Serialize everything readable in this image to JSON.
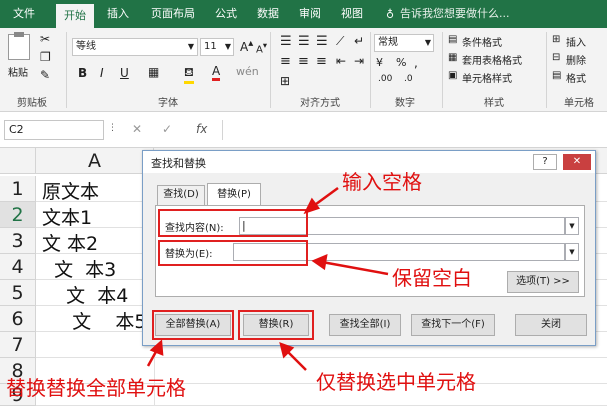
{
  "tabs": [
    "文件",
    "开始",
    "插入",
    "页面布局",
    "公式",
    "数据",
    "审阅",
    "视图"
  ],
  "tell_me": "告诉我您想要做什么...",
  "ribbon": {
    "paste": "粘贴",
    "clipboard": "剪贴板",
    "font_name": "等线",
    "font_size": "11",
    "bold": "B",
    "italic": "I",
    "underline": "U",
    "font_group": "字体",
    "align_group": "对齐方式",
    "number_format": "常规",
    "number_group": "数字",
    "conditional": "条件格式",
    "table_format": "套用表格格式",
    "cell_style": "单元格样式",
    "style_group": "样式",
    "insert": "插入",
    "delete": "删除",
    "format": "格式",
    "cells_group": "单元格"
  },
  "formula_bar": {
    "name_box": "C2",
    "fx": "fx"
  },
  "grid": {
    "col_a": "A",
    "rows": [
      {
        "num": "1",
        "text": "原文本"
      },
      {
        "num": "2",
        "text": "文本1"
      },
      {
        "num": "3",
        "text": "文 本2"
      },
      {
        "num": "4",
        "text": "  文  本3"
      },
      {
        "num": "5",
        "text": "    文  本4"
      },
      {
        "num": "6",
        "text": "     文    本5"
      },
      {
        "num": "7",
        "text": ""
      },
      {
        "num": "8",
        "text": ""
      },
      {
        "num": "9",
        "text": ""
      }
    ]
  },
  "dialog": {
    "title": "查找和替换",
    "help": "?",
    "close": "✕",
    "tab_find": "查找(D)",
    "tab_replace": "替换(P)",
    "find_label": "查找内容(N):",
    "replace_label": "替换为(E):",
    "options": "选项(T) >>",
    "replace_all": "全部替换(A)",
    "replace": "替换(R)",
    "find_all": "查找全部(I)",
    "find_next": "查找下一个(F)",
    "close_btn": "关闭"
  },
  "annotations": {
    "input_space": "输入空格",
    "keep_blank": "保留空白",
    "replace_all_cells": "替换替换全部单元格",
    "replace_selected": "仅替换选中单元格"
  }
}
